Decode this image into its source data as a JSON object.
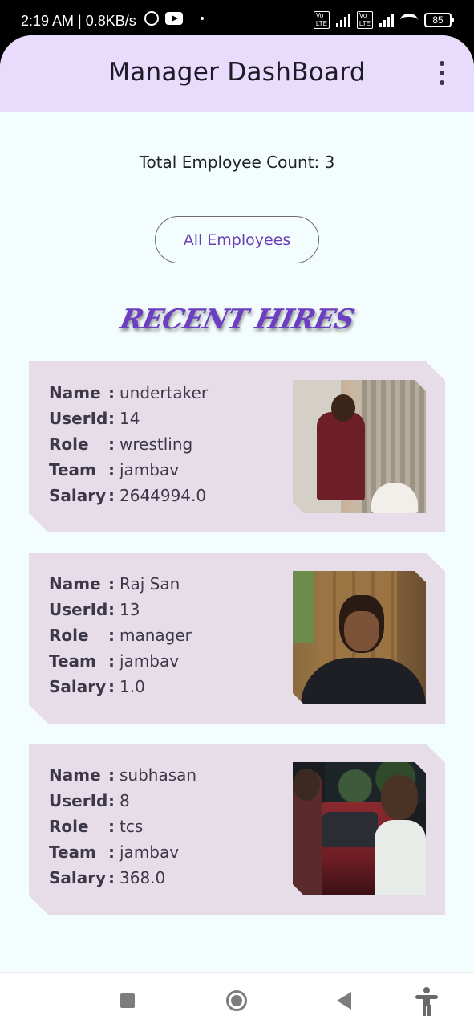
{
  "status_bar": {
    "time_text": "2:19 AM | 0.8KB/s",
    "battery": "85"
  },
  "app_bar": {
    "title": "Manager DashBoard",
    "menu_icon": "more-vert-icon"
  },
  "summary": {
    "count_text": "Total Employee Count: 3"
  },
  "actions": {
    "all_employees_label": "All Employees"
  },
  "section": {
    "title": "RECENT HIRES"
  },
  "labels": {
    "name": "Name",
    "userid": "UserId",
    "role": "Role",
    "team": "Team",
    "salary": "Salary",
    "colon": ":"
  },
  "employees": [
    {
      "name": "undertaker",
      "userid": "14",
      "role": "wrestling",
      "team": "jambav",
      "salary": "2644994.0"
    },
    {
      "name": "Raj San",
      "userid": "13",
      "role": "manager",
      "team": "jambav",
      "salary": "1.0"
    },
    {
      "name": "subhasan",
      "userid": "8",
      "role": "tcs",
      "team": "jambav",
      "salary": "368.0"
    }
  ],
  "colors": {
    "app_bar_bg": "#e8dbfb",
    "page_bg": "#f4fdfd",
    "card_bg": "#e6dde8",
    "accent": "#6a3fb5"
  }
}
